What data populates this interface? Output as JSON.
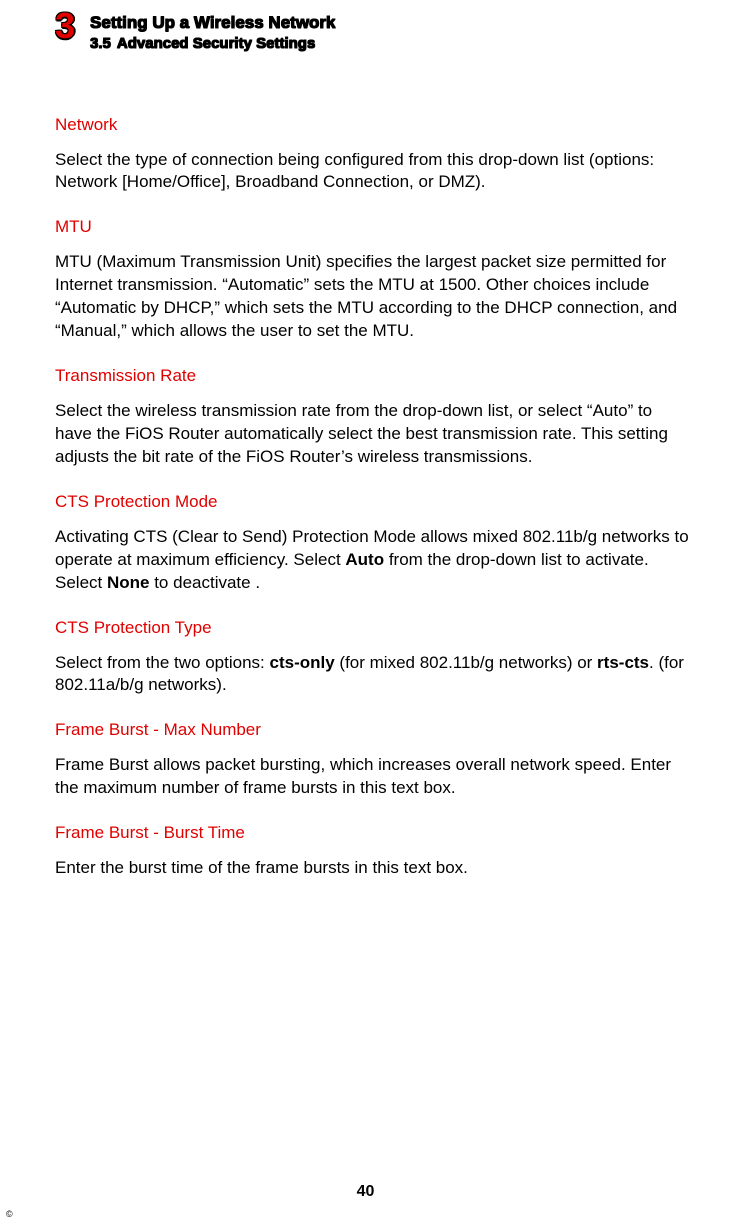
{
  "header": {
    "chapter_number": "3",
    "chapter_title": "Setting Up a Wireless Network",
    "section_number": "3.5",
    "section_title": "Advanced Security Settings"
  },
  "sections": {
    "network": {
      "heading": "Network",
      "body": "Select the type of connection being configured from this drop-down list (options: Network [Home/Office], Broadband Connection, or DMZ)."
    },
    "mtu": {
      "heading": "MTU",
      "body": "MTU (Maximum Transmission Unit) specifies the largest packet size permitted for Internet transmission. “Automatic” sets the MTU at 1500. Other choices include “Automatic by DHCP,” which sets the MTU according to the DHCP connection, and “Manual,” which allows the user to set the MTU."
    },
    "transmission_rate": {
      "heading": "Transmission Rate",
      "body": "Select the wireless transmission rate from the drop-down list, or select “Auto” to have the FiOS Router automatically select the best transmission rate. This setting adjusts the bit rate of the FiOS Router’s wireless transmissions."
    },
    "cts_protection_mode": {
      "heading": "CTS Protection Mode",
      "body_pre": "Activating CTS (Clear to Send) Protection Mode allows mixed 802.11b/g networks to operate at maximum efficiency. Select ",
      "bold1": "Auto",
      "body_mid": " from the drop-down list to activate. Select ",
      "bold2": "None",
      "body_post": " to deactivate ."
    },
    "cts_protection_type": {
      "heading": "CTS Protection Type",
      "body_pre": "Select from the two options: ",
      "bold1": "cts-only",
      "body_mid": " (for mixed 802.11b/g networks) or ",
      "bold2": "rts-cts",
      "body_post": ". (for 802.11a/b/g networks)."
    },
    "frame_burst_max": {
      "heading": "Frame Burst - Max Number",
      "body": "Frame Burst allows packet bursting, which increases overall network speed. Enter the maximum number of frame bursts in this text box."
    },
    "frame_burst_time": {
      "heading": "Frame Burst - Burst Time",
      "body": "Enter the burst time of the frame bursts in this text box."
    }
  },
  "page_number": "40",
  "copyright": "©"
}
